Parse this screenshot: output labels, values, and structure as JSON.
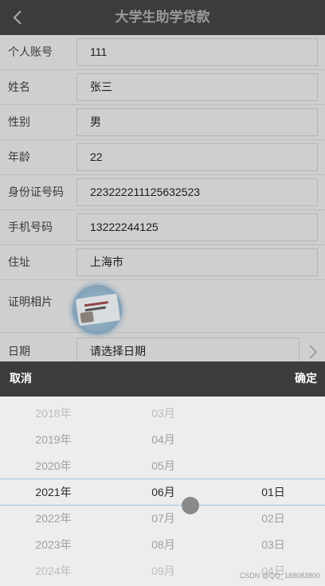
{
  "header": {
    "title": "大学生助学贷款"
  },
  "form": {
    "fields": [
      {
        "label": "个人账号",
        "value": "111"
      },
      {
        "label": "姓名",
        "value": "张三"
      },
      {
        "label": "性别",
        "value": "男"
      },
      {
        "label": "年龄",
        "value": "22"
      },
      {
        "label": "身份证号码",
        "value": "223222211125632523"
      },
      {
        "label": "手机号码",
        "value": "13222244125"
      },
      {
        "label": "住址",
        "value": "上海市"
      }
    ],
    "photo_label": "证明相片",
    "date_label": "日期",
    "date_placeholder": "请选择日期"
  },
  "picker": {
    "cancel_label": "取消",
    "confirm_label": "确定",
    "years": [
      "2018年",
      "2019年",
      "2020年",
      "2021年",
      "2022年",
      "2023年",
      "2024年"
    ],
    "months": [
      "03月",
      "04月",
      "05月",
      "06月",
      "07月",
      "08月",
      "09月"
    ],
    "days": [
      "01日",
      "02日",
      "03日",
      "04日"
    ],
    "selected": {
      "year": "2021年",
      "month": "06月",
      "day": "01日"
    }
  },
  "watermark": "CSDN @QQ_188083800"
}
